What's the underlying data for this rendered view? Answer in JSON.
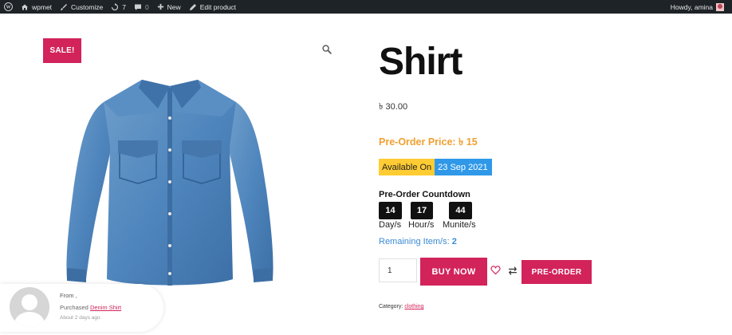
{
  "adminbar": {
    "site": "wpmet",
    "customize": "Customize",
    "updates_count": "7",
    "comments_count": "0",
    "new": "New",
    "edit_product": "Edit product",
    "howdy": "Howdy, amina",
    "icons": [
      "wordpress-icon",
      "home-icon",
      "brush-icon",
      "refresh-icon",
      "comment-icon",
      "plus-icon",
      "pencil-icon"
    ]
  },
  "product": {
    "sale_badge": "SALE!",
    "title": "Shirt",
    "price": "৳ 30.00",
    "preorder_price": "Pre-Order Price: ৳ 15",
    "available_on_label": "Available On",
    "available_date": "23 Sep 2021",
    "countdown_title": "Pre-Order Countdown",
    "countdown": [
      {
        "value": "14",
        "label": "Day/s"
      },
      {
        "value": "17",
        "label": "Hour/s"
      },
      {
        "value": "44",
        "label": "Munite/s"
      }
    ],
    "remaining_label": "Remaining Item/s:",
    "remaining_value": "2",
    "quantity": "1",
    "buy_now": "BUY NOW",
    "pre_order": "PRE-ORDER",
    "category_label": "Category:",
    "category_value": "clothing"
  },
  "notification": {
    "from": "From ,",
    "purchased_label": "Purchased",
    "product_link": "Denim Shirt",
    "time_ago": "About 2 days ago"
  },
  "colors": {
    "accent": "#d2235b",
    "admin_bar": "#1d2327",
    "preorder_price": "#f0a031",
    "available_label_bg": "#ffcc33",
    "available_date_bg": "#2f98e8",
    "remaining_text": "#3b8bd4"
  }
}
